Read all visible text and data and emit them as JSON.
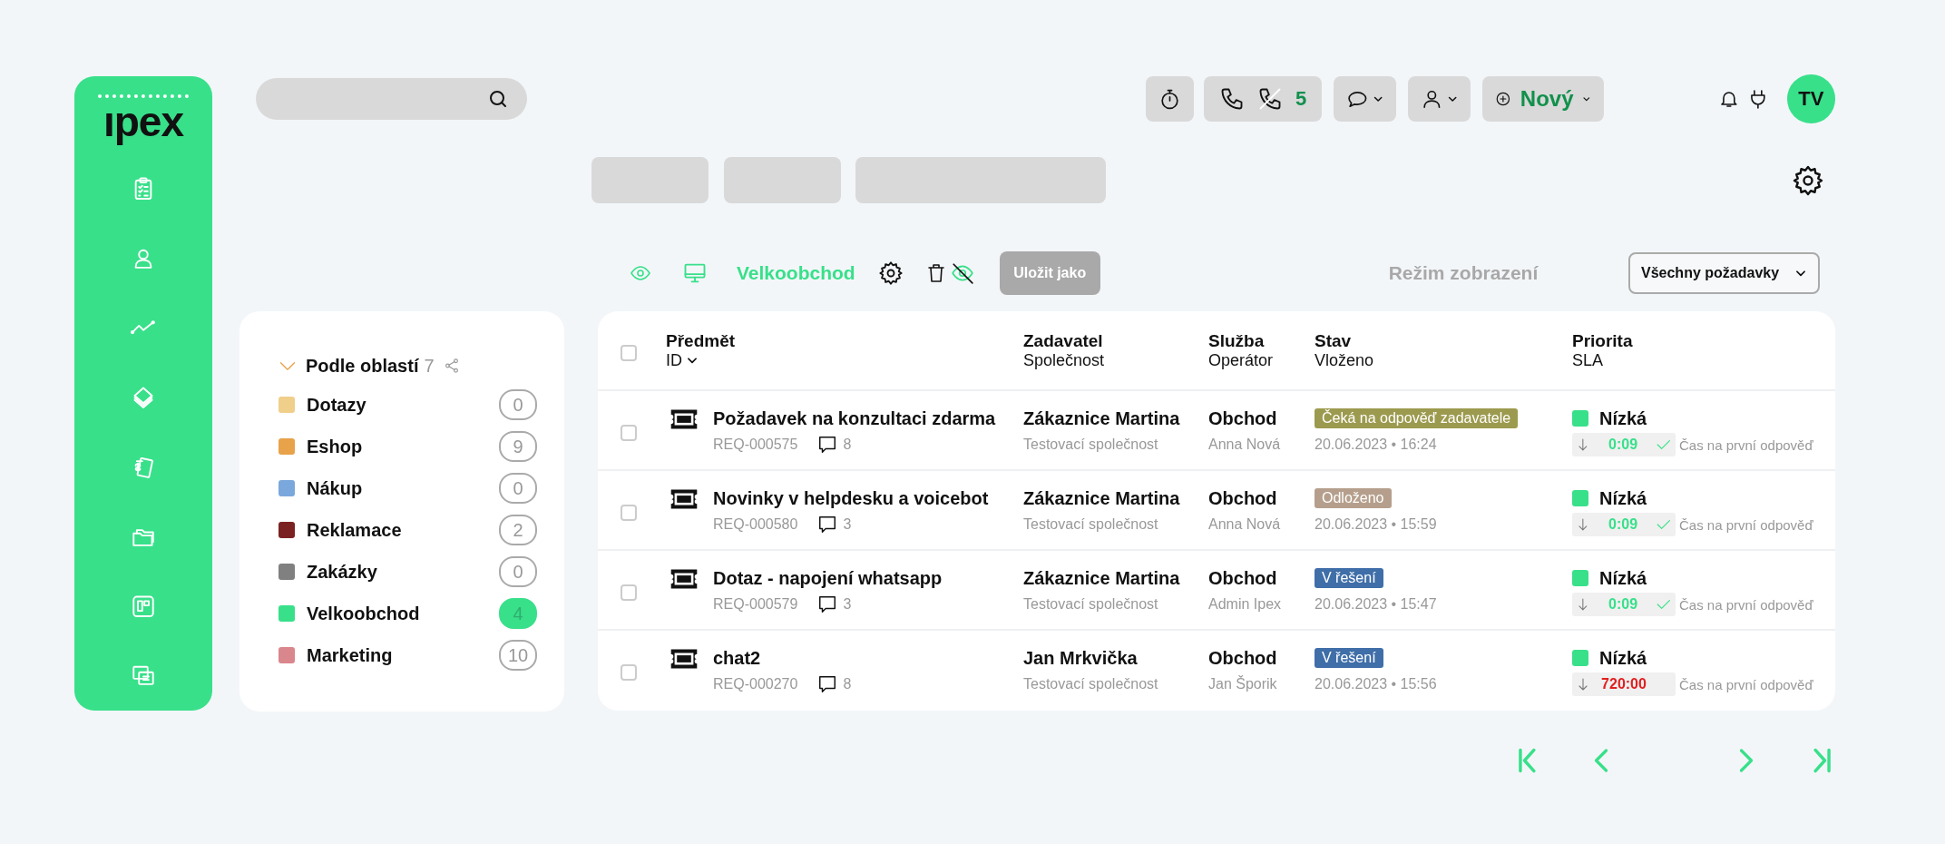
{
  "sidebar": {
    "logo": "ıpex"
  },
  "topbar": {
    "missed_calls": "5",
    "new_button": "Nový",
    "avatar": "TV"
  },
  "toolbar": {
    "filter_name": "Velkoobchod",
    "save_button": "Uložit jako",
    "view_mode_label": "Režim zobrazení",
    "view_mode_select": "Všechny požadavky"
  },
  "areas": {
    "title": "Podle oblastí",
    "count": "7",
    "expanded": true,
    "items": [
      {
        "name": "Dotazy",
        "count": "0",
        "color": "#f0cf8a",
        "selected": false
      },
      {
        "name": "Eshop",
        "count": "9",
        "color": "#e8a24a",
        "selected": false
      },
      {
        "name": "Nákup",
        "count": "0",
        "color": "#7aa8dc",
        "selected": false
      },
      {
        "name": "Reklamace",
        "count": "2",
        "color": "#7a2222",
        "selected": false
      },
      {
        "name": "Zakázky",
        "count": "0",
        "color": "#808080",
        "selected": false
      },
      {
        "name": "Velkoobchod",
        "count": "4",
        "color": "#38e08a",
        "selected": true
      },
      {
        "name": "Marketing",
        "count": "10",
        "color": "#d9868c",
        "selected": false
      }
    ]
  },
  "table": {
    "select_all_checked": false,
    "columns": [
      {
        "title": "Předmět",
        "subtitle": "ID"
      },
      {
        "title": "Zadavatel",
        "subtitle": "Společnost"
      },
      {
        "title": "Služba",
        "subtitle": "Operátor"
      },
      {
        "title": "Stav",
        "subtitle": "Vloženo"
      },
      {
        "title": "Priorita",
        "subtitle": "SLA"
      }
    ],
    "rows": [
      {
        "checked": false,
        "subject": "Požadavek na konzultaci zdarma",
        "id": "REQ-000575",
        "comments": "8",
        "requester": "Zákaznice Martina",
        "company": "Testovací společnost",
        "service": "Obchod",
        "operator": "Anna Nová",
        "status": {
          "label": "Čeká na odpověď zadavatele",
          "color": "#9c9a4e"
        },
        "created": "20.06.2023 • 16:24",
        "priority": {
          "label": "Nízká",
          "color": "#38e08a"
        },
        "sla_time": "0:09",
        "sla_met": true,
        "sla_label": "Čas na první odpověď"
      },
      {
        "checked": false,
        "subject": "Novinky v helpdesku a voicebot",
        "id": "REQ-000580",
        "comments": "3",
        "requester": "Zákaznice Martina",
        "company": "Testovací společnost",
        "service": "Obchod",
        "operator": "Anna Nová",
        "status": {
          "label": "Odloženo",
          "color": "#b59f8c"
        },
        "created": "20.06.2023 • 15:59",
        "priority": {
          "label": "Nízká",
          "color": "#38e08a"
        },
        "sla_time": "0:09",
        "sla_met": true,
        "sla_label": "Čas na první odpověď"
      },
      {
        "checked": false,
        "subject": "Dotaz - napojení whatsapp",
        "id": "REQ-000579",
        "comments": "3",
        "requester": "Zákaznice Martina",
        "company": "Testovací společnost",
        "service": "Obchod",
        "operator": "Admin Ipex",
        "status": {
          "label": "V řešení",
          "color": "#3f6ea8"
        },
        "created": "20.06.2023 • 15:47",
        "priority": {
          "label": "Nízká",
          "color": "#38e08a"
        },
        "sla_time": "0:09",
        "sla_met": true,
        "sla_label": "Čas na první odpověď"
      },
      {
        "checked": false,
        "subject": "chat2",
        "id": "REQ-000270",
        "comments": "8",
        "requester": "Jan Mrkvička",
        "company": "Testovací společnost",
        "service": "Obchod",
        "operator": "Jan Šporik",
        "status": {
          "label": "V řešení",
          "color": "#3f6ea8"
        },
        "created": "20.06.2023 • 15:56",
        "priority": {
          "label": "Nízká",
          "color": "#38e08a"
        },
        "sla_time": "720:00",
        "sla_met": false,
        "sla_label": "Čas na první odpověď"
      }
    ]
  }
}
